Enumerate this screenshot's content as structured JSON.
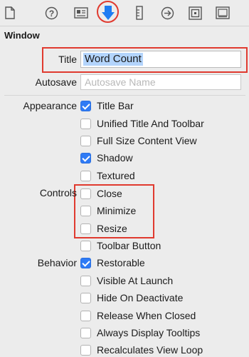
{
  "toolbar": {
    "icons": [
      {
        "name": "file-inspector-icon"
      },
      {
        "name": "quick-help-icon"
      },
      {
        "name": "identity-inspector-icon"
      },
      {
        "name": "attributes-inspector-icon",
        "selected": true
      },
      {
        "name": "size-inspector-icon"
      },
      {
        "name": "connections-inspector-icon"
      },
      {
        "name": "bindings-inspector-icon"
      },
      {
        "name": "view-effects-inspector-icon"
      }
    ]
  },
  "section": {
    "title": "Window"
  },
  "title_field": {
    "label": "Title",
    "value": "Word Count"
  },
  "autosave_field": {
    "label": "Autosave",
    "placeholder": "Autosave Name"
  },
  "appearance": {
    "label": "Appearance",
    "options": [
      {
        "label": "Title Bar",
        "checked": true
      },
      {
        "label": "Unified Title And Toolbar",
        "checked": false
      },
      {
        "label": "Full Size Content View",
        "checked": false
      },
      {
        "label": "Shadow",
        "checked": true
      },
      {
        "label": "Textured",
        "checked": false
      }
    ]
  },
  "controls": {
    "label": "Controls",
    "options": [
      {
        "label": "Close",
        "checked": false
      },
      {
        "label": "Minimize",
        "checked": false
      },
      {
        "label": "Resize",
        "checked": false
      },
      {
        "label": "Toolbar Button",
        "checked": false
      }
    ]
  },
  "behavior": {
    "label": "Behavior",
    "options": [
      {
        "label": "Restorable",
        "checked": true
      },
      {
        "label": "Visible At Launch",
        "checked": false
      },
      {
        "label": "Hide On Deactivate",
        "checked": false
      },
      {
        "label": "Release When Closed",
        "checked": false
      },
      {
        "label": "Always Display Tooltips",
        "checked": false
      },
      {
        "label": "Recalculates View Loop",
        "checked": false
      }
    ]
  },
  "colors": {
    "accent": "#2f7bf5",
    "highlight": "#e03a2f",
    "selection": "#b3d4fc"
  }
}
